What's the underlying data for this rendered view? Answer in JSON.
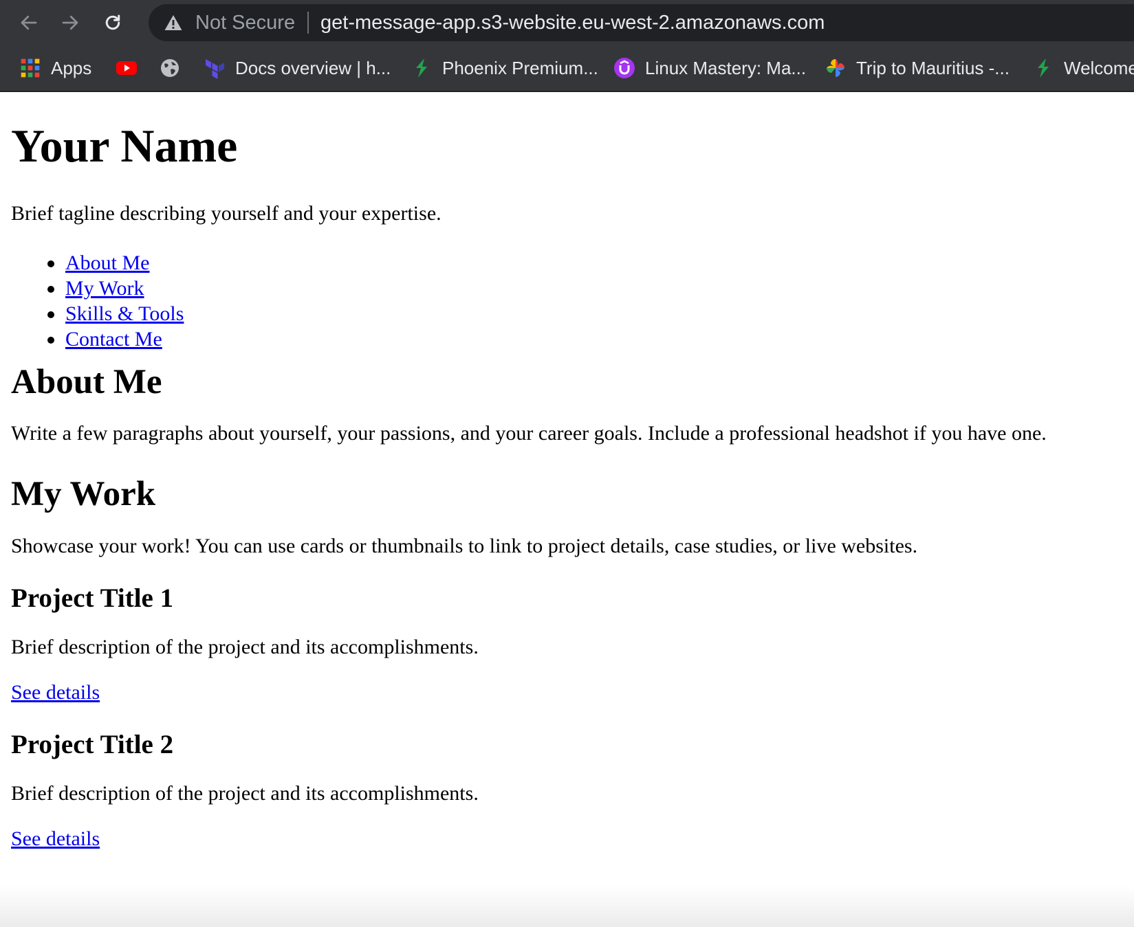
{
  "browser": {
    "security_label": "Not Secure",
    "url": "get-message-app.s3-website.eu-west-2.amazonaws.com",
    "bookmarks": [
      {
        "label": "Apps",
        "icon": "apps-grid-icon"
      },
      {
        "label": "",
        "icon": "youtube-icon"
      },
      {
        "label": "",
        "icon": "globe-icon"
      },
      {
        "label": "Docs overview | h...",
        "icon": "terraform-icon"
      },
      {
        "label": "Phoenix Premium...",
        "icon": "phoenix-icon"
      },
      {
        "label": "Linux Mastery: Ma...",
        "icon": "udemy-icon"
      },
      {
        "label": "Trip to Mauritius -...",
        "icon": "photos-pinwheel-icon"
      },
      {
        "label": "Welcome",
        "icon": "phoenix-icon"
      }
    ]
  },
  "page": {
    "title": "Your Name",
    "tagline": "Brief tagline describing yourself and your expertise.",
    "nav": [
      {
        "label": "About Me"
      },
      {
        "label": "My Work"
      },
      {
        "label": "Skills & Tools"
      },
      {
        "label": "Contact Me"
      }
    ],
    "about": {
      "heading": "About Me",
      "text": "Write a few paragraphs about yourself, your passions, and your career goals. Include a professional headshot if you have one."
    },
    "work": {
      "heading": "My Work",
      "text": "Showcase your work! You can use cards or thumbnails to link to project details, case studies, or live websites.",
      "projects": [
        {
          "title": "Project Title 1",
          "description": "Brief description of the project and its accomplishments.",
          "link": "See details"
        },
        {
          "title": "Project Title 2",
          "description": "Brief description of the project and its accomplishments.",
          "link": "See details"
        }
      ]
    }
  },
  "colors": {
    "chrome_bg": "#35363a",
    "omnibox_bg": "#202124",
    "link": "#0000ee"
  }
}
